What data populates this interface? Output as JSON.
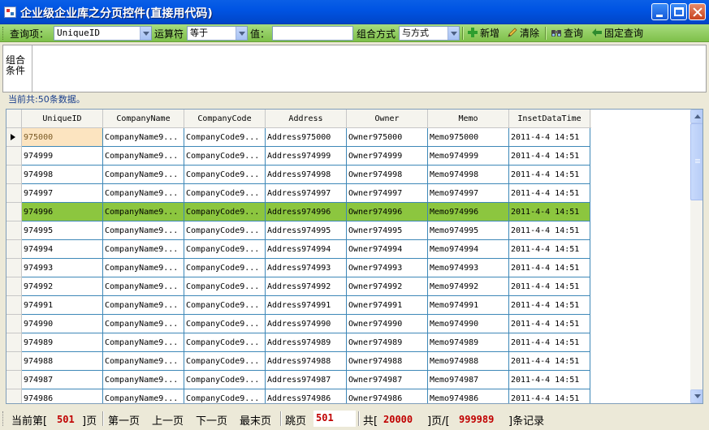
{
  "window": {
    "title": "企业级企业库之分页控件(直接用代码)"
  },
  "toolbar": {
    "query_item_label": "查询项：",
    "query_item_value": "UniqueID",
    "operator_label": "运算符",
    "operator_value": "等于",
    "value_label": "值：",
    "value_text": "",
    "combine_label": "组合方式",
    "combine_value": "与方式",
    "add_label": "新增",
    "clear_label": "清除",
    "query_label": "查询",
    "fixed_query_label": "固定查询"
  },
  "condition_panel": {
    "label": "组合条件"
  },
  "status": {
    "text": "当前共:50条数据。"
  },
  "grid": {
    "columns": [
      "UniqueID",
      "CompanyName",
      "CompanyCode",
      "Address",
      "Owner",
      "Memo",
      "InsetDataTime"
    ],
    "rows": [
      [
        "975000",
        "CompanyName9...",
        "CompanyCode9...",
        "Address975000",
        "Owner975000",
        "Memo975000",
        "2011-4-4 14:51"
      ],
      [
        "974999",
        "CompanyName9...",
        "CompanyCode9...",
        "Address974999",
        "Owner974999",
        "Memo974999",
        "2011-4-4 14:51"
      ],
      [
        "974998",
        "CompanyName9...",
        "CompanyCode9...",
        "Address974998",
        "Owner974998",
        "Memo974998",
        "2011-4-4 14:51"
      ],
      [
        "974997",
        "CompanyName9...",
        "CompanyCode9...",
        "Address974997",
        "Owner974997",
        "Memo974997",
        "2011-4-4 14:51"
      ],
      [
        "974996",
        "CompanyName9...",
        "CompanyCode9...",
        "Address974996",
        "Owner974996",
        "Memo974996",
        "2011-4-4 14:51"
      ],
      [
        "974995",
        "CompanyName9...",
        "CompanyCode9...",
        "Address974995",
        "Owner974995",
        "Memo974995",
        "2011-4-4 14:51"
      ],
      [
        "974994",
        "CompanyName9...",
        "CompanyCode9...",
        "Address974994",
        "Owner974994",
        "Memo974994",
        "2011-4-4 14:51"
      ],
      [
        "974993",
        "CompanyName9...",
        "CompanyCode9...",
        "Address974993",
        "Owner974993",
        "Memo974993",
        "2011-4-4 14:51"
      ],
      [
        "974992",
        "CompanyName9...",
        "CompanyCode9...",
        "Address974992",
        "Owner974992",
        "Memo974992",
        "2011-4-4 14:51"
      ],
      [
        "974991",
        "CompanyName9...",
        "CompanyCode9...",
        "Address974991",
        "Owner974991",
        "Memo974991",
        "2011-4-4 14:51"
      ],
      [
        "974990",
        "CompanyName9...",
        "CompanyCode9...",
        "Address974990",
        "Owner974990",
        "Memo974990",
        "2011-4-4 14:51"
      ],
      [
        "974989",
        "CompanyName9...",
        "CompanyCode9...",
        "Address974989",
        "Owner974989",
        "Memo974989",
        "2011-4-4 14:51"
      ],
      [
        "974988",
        "CompanyName9...",
        "CompanyCode9...",
        "Address974988",
        "Owner974988",
        "Memo974988",
        "2011-4-4 14:51"
      ],
      [
        "974987",
        "CompanyName9...",
        "CompanyCode9...",
        "Address974987",
        "Owner974987",
        "Memo974987",
        "2011-4-4 14:51"
      ],
      [
        "974986",
        "CompanyName9...",
        "CompanyCode9...",
        "Address974986",
        "Owner974986",
        "Memo974986",
        "2011-4-4 14:51"
      ]
    ]
  },
  "pager": {
    "current_prefix": "当前第[",
    "current_page": "501",
    "current_suffix": "]页",
    "first": "第一页",
    "prev": "上一页",
    "next": "下一页",
    "last": "最末页",
    "jump_label": "跳页",
    "jump_value": "501",
    "total_prefix": "共[",
    "total_pages": "20000",
    "total_mid": "]页/[",
    "total_records": "999989",
    "total_suffix": "]条记录"
  },
  "colors": {
    "selected_row": "#8cc63f",
    "toolbar": "#8fcb5c",
    "accent_red": "#c00000"
  }
}
